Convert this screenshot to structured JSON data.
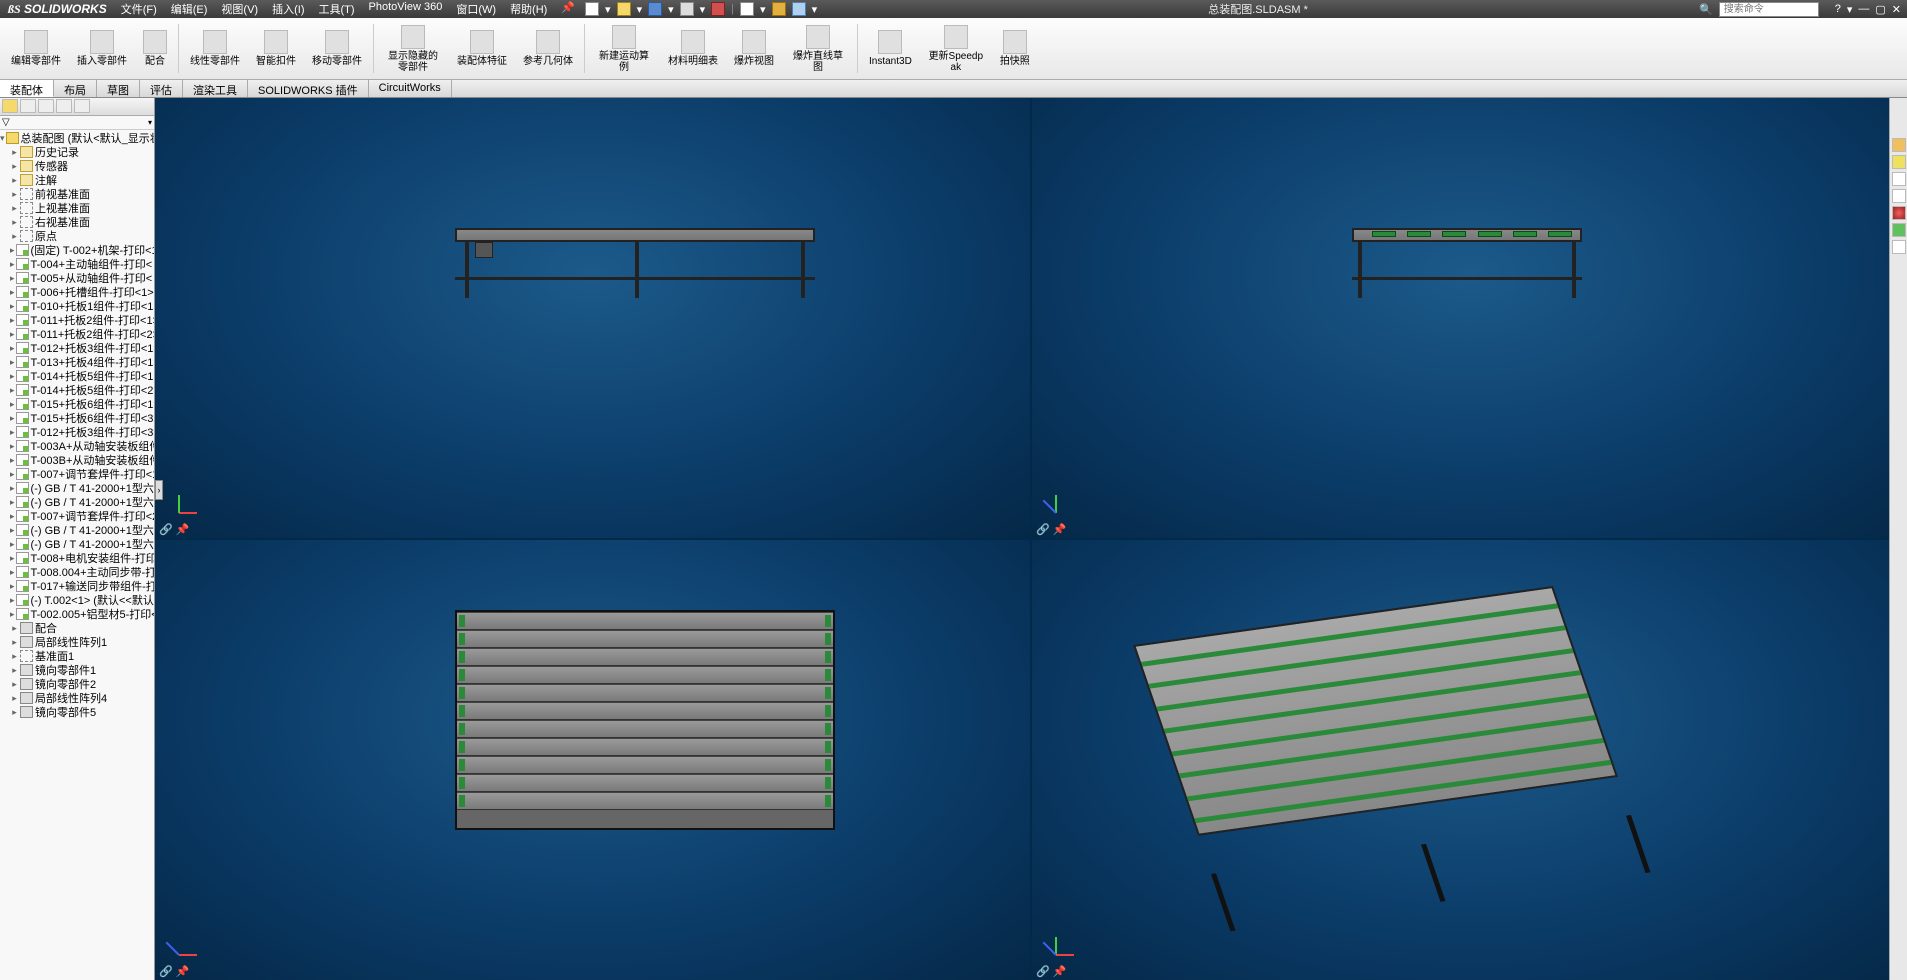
{
  "app": {
    "name": "SOLIDWORKS",
    "doc_title": "总装配图.SLDASM *",
    "search_placeholder": "搜索命令"
  },
  "menu": [
    "文件(F)",
    "编辑(E)",
    "视图(V)",
    "插入(I)",
    "工具(T)",
    "PhotoView 360",
    "窗口(W)",
    "帮助(H)"
  ],
  "ribbon": [
    {
      "label": "编辑零部件"
    },
    {
      "label": "插入零部件"
    },
    {
      "label": "配合"
    },
    {
      "label": "线性零部件"
    },
    {
      "label": "智能扣件"
    },
    {
      "label": "移动零部件"
    },
    {
      "label": "显示隐藏的零部件"
    },
    {
      "label": "装配体特征"
    },
    {
      "label": "参考几何体"
    },
    {
      "label": "新建运动算例"
    },
    {
      "label": "材料明细表"
    },
    {
      "label": "爆炸视图"
    },
    {
      "label": "爆炸直线草图"
    },
    {
      "label": "Instant3D"
    },
    {
      "label": "更新Speedpak"
    },
    {
      "label": "拍快照"
    }
  ],
  "tabs": [
    "装配体",
    "布局",
    "草图",
    "评估",
    "渲染工具",
    "SOLIDWORKS 插件",
    "CircuitWorks"
  ],
  "tree": {
    "root": "总装配图  (默认<默认_显示状态",
    "top": [
      "历史记录",
      "传感器",
      "注解",
      "前视基准面",
      "上视基准面",
      "右视基准面",
      "原点"
    ],
    "parts": [
      "(固定) T-002+机架-打印<1",
      "T-004+主动轴组件-打印<",
      "T-005+从动轴组件-打印<",
      "T-006+托槽组件-打印<1>",
      "T-010+托板1组件-打印<1>",
      "T-011+托板2组件-打印<1>",
      "T-011+托板2组件-打印<2>",
      "T-012+托板3组件-打印<1>",
      "T-013+托板4组件-打印<1>",
      "T-014+托板5组件-打印<1>",
      "T-014+托板5组件-打印<2>",
      "T-015+托板6组件-打印<1>",
      "T-015+托板6组件-打印<3>",
      "T-012+托板3组件-打印<3>",
      "T-003A+从动轴安装板组件",
      "T-003B+从动轴安装板组件",
      "T-007+调节套焊件-打印<1",
      "(-) GB / T 41-2000+1型六角",
      "(-) GB / T 41-2000+1型六角",
      "T-007+调节套焊件-打印<2",
      "(-) GB / T 41-2000+1型六角",
      "(-) GB / T 41-2000+1型六角",
      "T-008+电机安装组件-打印",
      "T-008.004+主动同步带-打印",
      "T-017+输送同步带组件-打",
      "(-) T.002<1> (默认<<默认",
      "T-002.005+铝型材5-打印<"
    ],
    "bottom": [
      "配合",
      "局部线性阵列1",
      "基准面1",
      "镜向零部件1",
      "镜向零部件2",
      "局部线性阵列4",
      "镜向零部件5"
    ]
  }
}
